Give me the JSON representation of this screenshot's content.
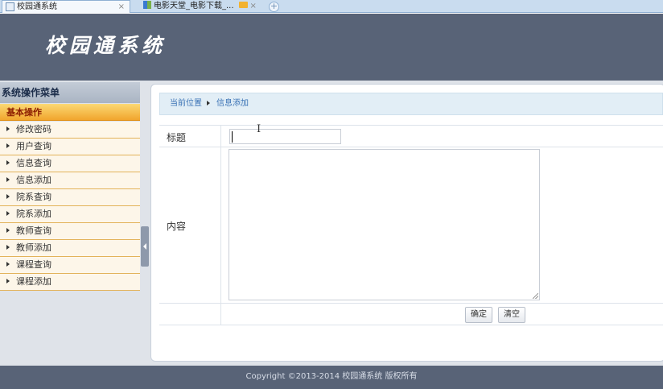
{
  "browser": {
    "tabs": [
      {
        "title": "校园通系统",
        "active": true
      },
      {
        "title": "电影天堂_电影下载_...",
        "active": false
      }
    ],
    "close_glyph": "×",
    "new_tab_glyph": "+"
  },
  "header": {
    "logo_text": "校园通系统"
  },
  "sidebar": {
    "title": "系统操作菜单",
    "section": "基本操作",
    "items": [
      {
        "label": "修改密码"
      },
      {
        "label": "用户查询"
      },
      {
        "label": "信息查询"
      },
      {
        "label": "信息添加"
      },
      {
        "label": "院系查询"
      },
      {
        "label": "院系添加"
      },
      {
        "label": "教师查询"
      },
      {
        "label": "教师添加"
      },
      {
        "label": "课程查询"
      },
      {
        "label": "课程添加"
      }
    ]
  },
  "breadcrumb": {
    "current_label": "当前位置",
    "page": "信息添加"
  },
  "form": {
    "title_label": "标题",
    "title_value": "",
    "content_label": "内容",
    "content_value": "",
    "submit_label": "确定",
    "reset_label": "清空"
  },
  "footer": {
    "copyright": "Copyright ©2013-2014 校园通系统 版权所有"
  },
  "colors": {
    "header_bg": "#586377",
    "menu_section": "#f1a52d",
    "breadcrumb_bg": "#e2eef6",
    "link": "#3a72b5"
  }
}
